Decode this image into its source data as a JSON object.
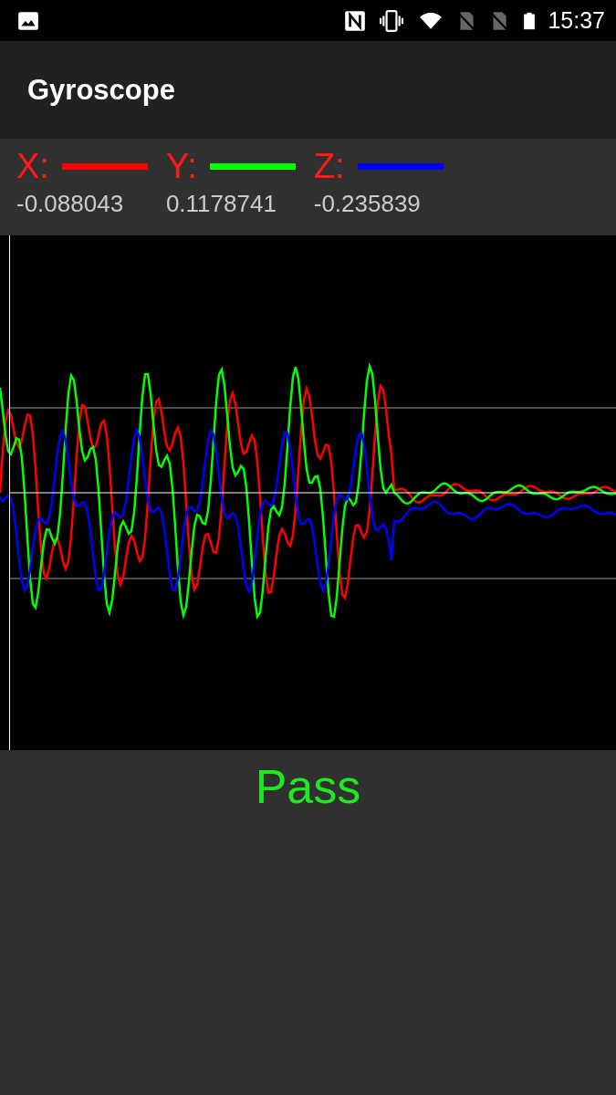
{
  "status_bar": {
    "time": "15:37"
  },
  "app_bar": {
    "title": "Gyroscope"
  },
  "axes": [
    {
      "label": "X:",
      "color": "#ff0000",
      "reading": "-0.088043"
    },
    {
      "label": "Y:",
      "color": "#00ff00",
      "reading": "0.1178741"
    },
    {
      "label": "Z:",
      "color": "#0000ff",
      "reading": "-0.235839"
    }
  ],
  "result": {
    "text": "Pass"
  }
}
